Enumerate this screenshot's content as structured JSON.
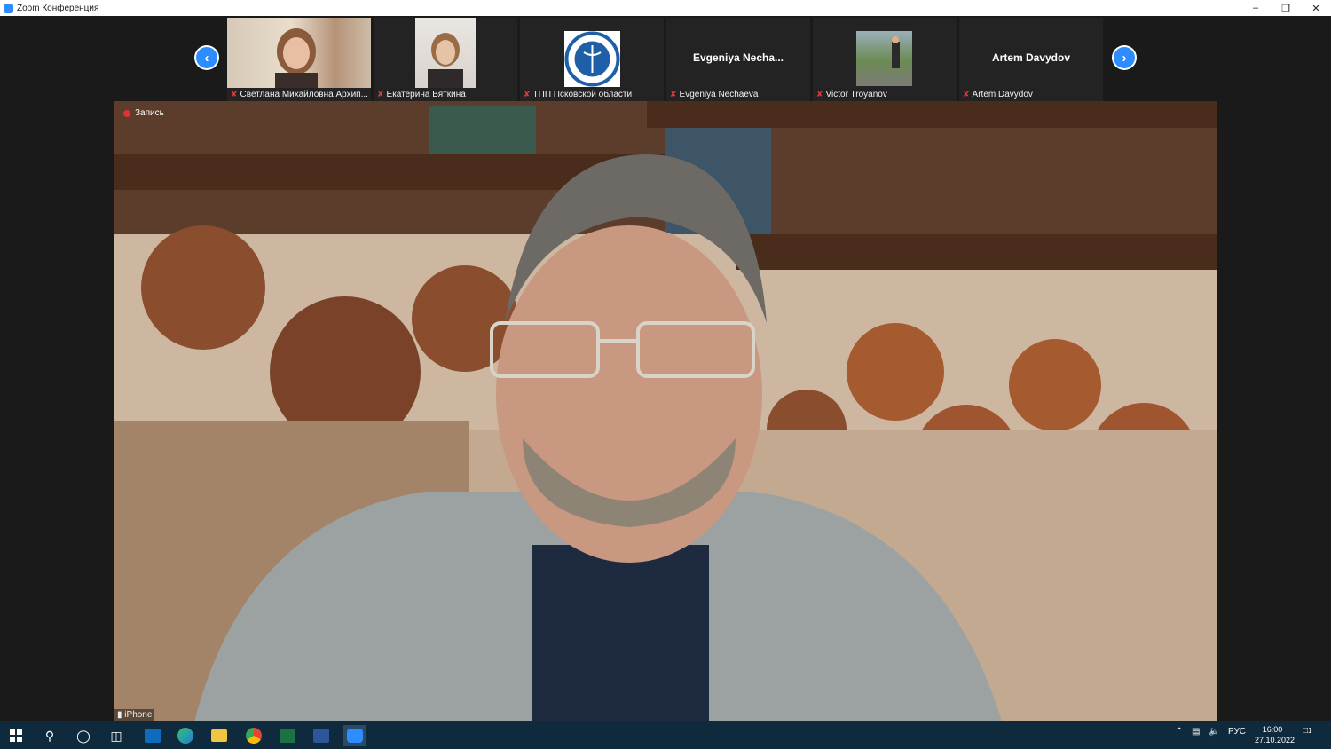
{
  "window": {
    "title": "Zoom Конференция"
  },
  "participants": [
    {
      "name": "Светлана Михайловна Архип...",
      "display": ""
    },
    {
      "name": "Екатерина Вяткина",
      "display": ""
    },
    {
      "name": "ТПП Псковской области",
      "display": ""
    },
    {
      "name": "Evgeniya Nechaeva",
      "display": "Evgeniya  Necha..."
    },
    {
      "name": "Victor Troyanov",
      "display": ""
    },
    {
      "name": "Artem Davydov",
      "display": "Artem Davydov"
    }
  ],
  "main_video": {
    "recording_label": "Запись",
    "device_label": "iPhone"
  },
  "taskbar": {
    "language": "РУС",
    "time": "16:00",
    "date": "27.10.2022",
    "notification_count": "1"
  },
  "colors": {
    "accent": "#2d8cff",
    "mic_muted": "#e23b3b",
    "recording": "#e03131",
    "taskbar": "#0f2a3c"
  }
}
